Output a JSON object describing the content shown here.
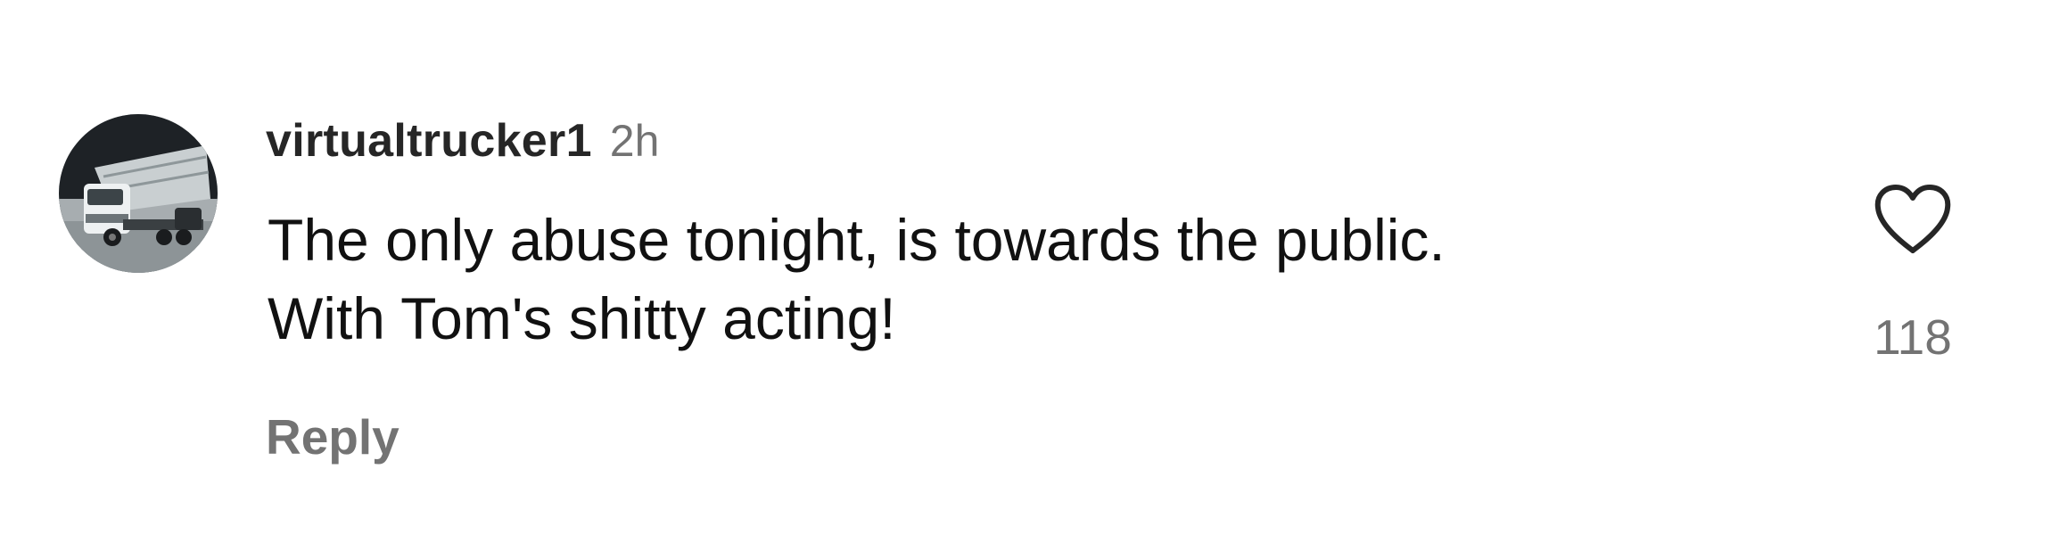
{
  "comment": {
    "username": "virtualtrucker1",
    "timestamp": "2h",
    "text_lines": [
      "The only abuse tonight, is towards the public.",
      "With Tom's shitty acting!"
    ],
    "reply_label": "Reply",
    "like_count": "118",
    "like_icon": "heart-outline-icon",
    "avatar_icon": "truck-avatar"
  },
  "colors": {
    "text": "#111111",
    "username": "#262626",
    "muted": "#737373",
    "background": "#ffffff"
  }
}
